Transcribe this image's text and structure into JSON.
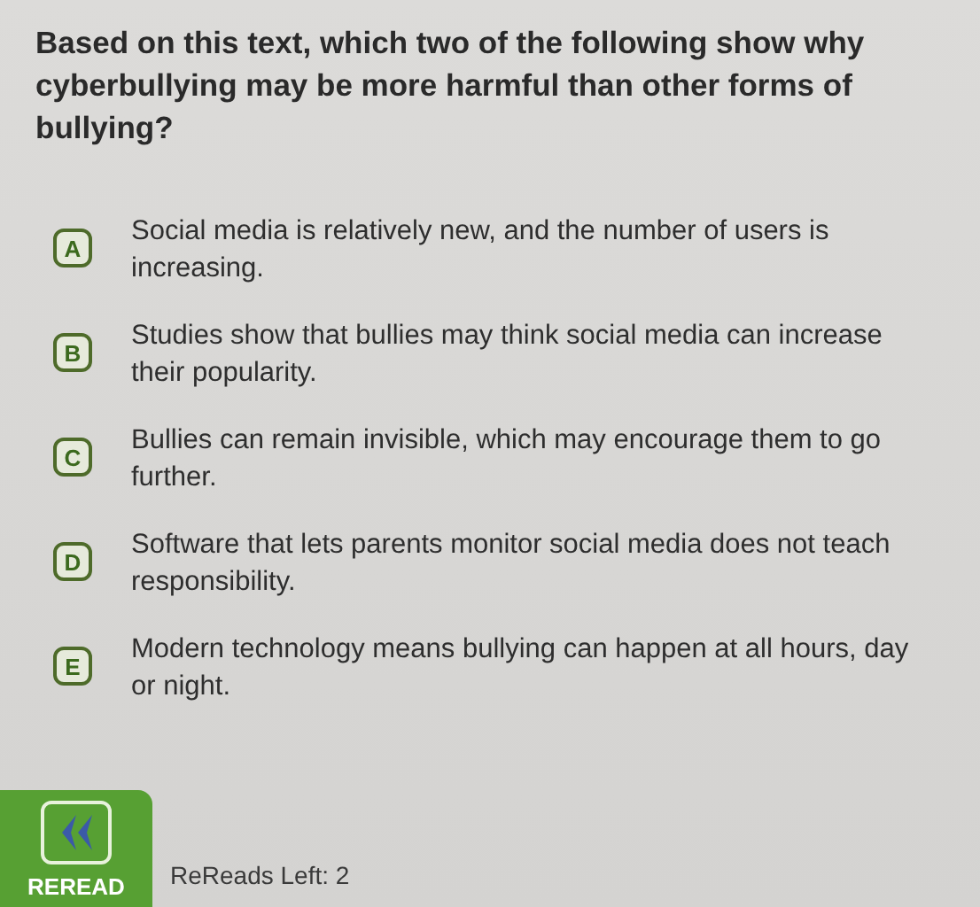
{
  "question": "Based on this text, which two of the following show why cyberbullying may be more harmful than other forms of bullying?",
  "options": [
    {
      "letter": "A",
      "text": "Social media is relatively new, and the number of users is increasing.",
      "selected": false
    },
    {
      "letter": "B",
      "text": "Studies show that bullies may think social media can increase their popularity.",
      "selected": false
    },
    {
      "letter": "C",
      "text": "Bullies can remain invisible, which may encourage them to go further.",
      "selected": false
    },
    {
      "letter": "D",
      "text": "Software that lets parents monitor social media does not teach responsibility.",
      "selected": false
    },
    {
      "letter": "E",
      "text": "Modern technology means bullying can happen at all hours, day or night.",
      "selected": false
    }
  ],
  "reread": {
    "label": "REREAD",
    "left": "ReReads Left: 2"
  }
}
